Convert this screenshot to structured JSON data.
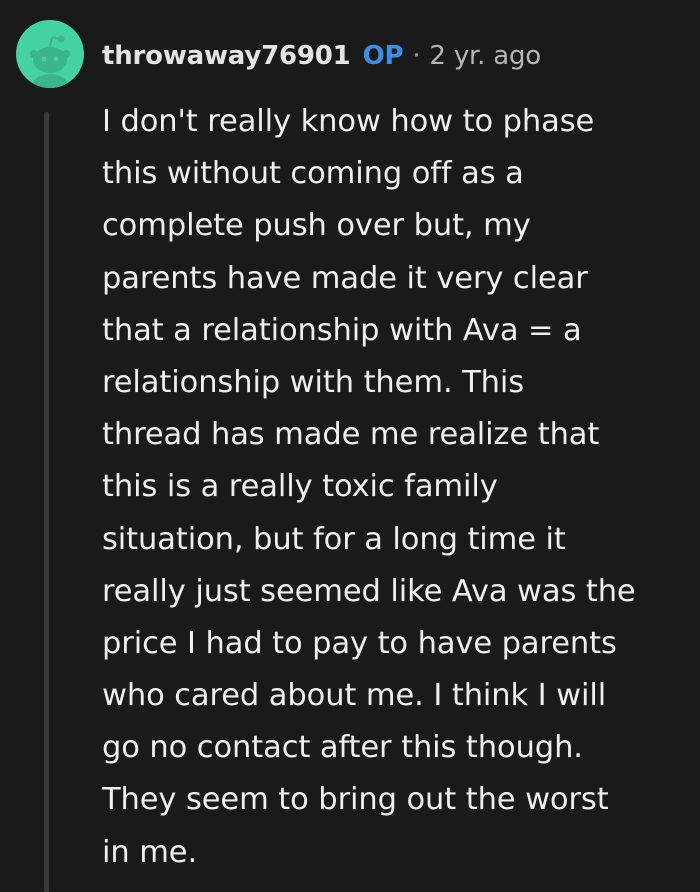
{
  "comment": {
    "username": "throwaway76901",
    "op_badge": "OP",
    "separator": "·",
    "timestamp": "2 yr. ago",
    "avatar_icon": "reddit-snoo-avatar-icon",
    "avatar_color": "#46d3a4",
    "body_lines": [
      "I don't really know how to phase",
      "this without coming off as a",
      "complete push over but, my",
      "parents have made it very clear",
      "that a relationship with Ava = a",
      "relationship with them. This",
      "thread has made me realize that",
      "this is a really toxic family",
      "situation, but for a long time it",
      "really just seemed like Ava was the",
      "price I had to pay to have parents",
      "who cared about me. I think I will",
      "go no contact after this though.",
      "They seem to bring out the worst",
      "in me."
    ]
  },
  "colors": {
    "background": "#1a1a1b",
    "op_badge": "#3b8de6",
    "thread_line": "#3a3a3c"
  }
}
